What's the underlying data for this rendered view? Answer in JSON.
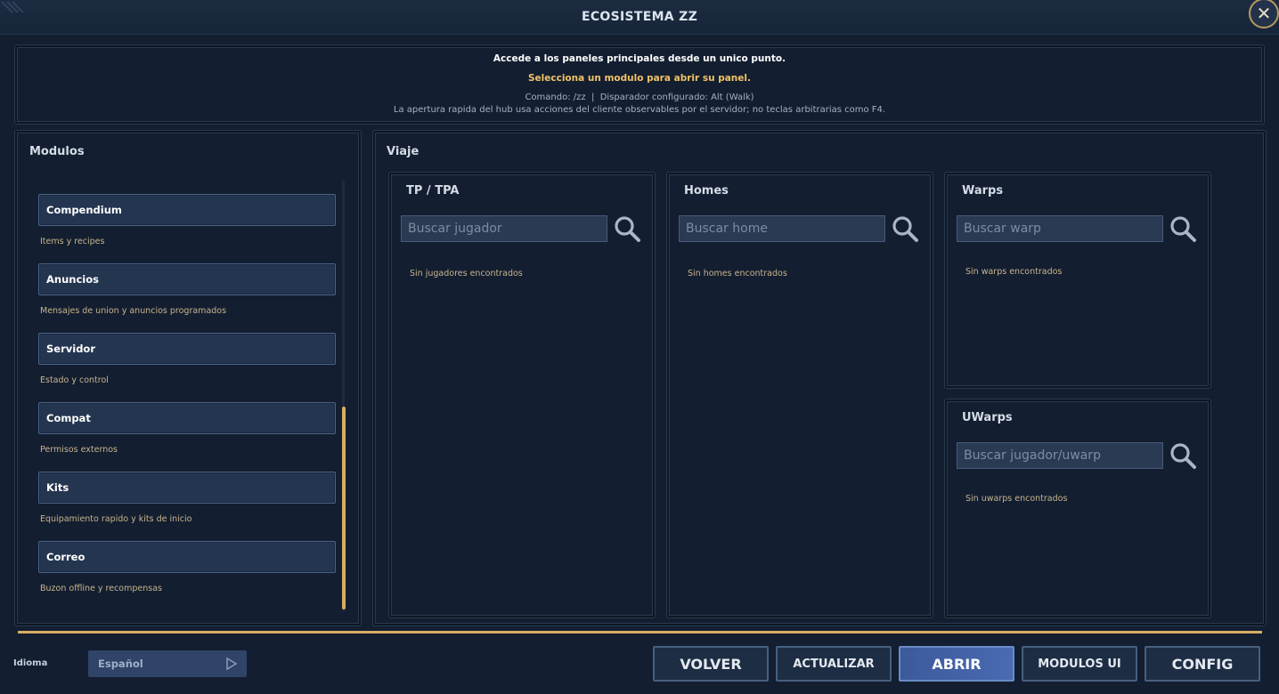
{
  "window": {
    "title": "ECOSISTEMA ZZ",
    "close_icon": "close-icon"
  },
  "header": {
    "line1": "Accede a los paneles principales desde un unico punto.",
    "line2": "Selecciona un modulo para abrir su panel.",
    "line3": "Comando: /zz  |  Disparador configurado: Alt (Walk)",
    "line4": "La apertura rapida del hub usa acciones del cliente observables por el servidor; no teclas arbitrarias como F4."
  },
  "modules": {
    "title": "Modulos",
    "items": [
      {
        "label": "Compendium",
        "desc": "Items y recipes"
      },
      {
        "label": "Anuncios",
        "desc": "Mensajes de union y anuncios programados"
      },
      {
        "label": "Servidor",
        "desc": "Estado y control"
      },
      {
        "label": "Compat",
        "desc": "Permisos externos"
      },
      {
        "label": "Kits",
        "desc": "Equipamiento rapido y kits de inicio"
      },
      {
        "label": "Correo",
        "desc": "Buzon offline y recompensas"
      }
    ]
  },
  "viaje": {
    "title": "Viaje",
    "tpa": {
      "title": "TP / TPA",
      "placeholder": "Buscar jugador",
      "empty": "Sin jugadores encontrados"
    },
    "homes": {
      "title": "Homes",
      "placeholder": "Buscar home",
      "empty": "Sin homes encontrados"
    },
    "warps": {
      "title": "Warps",
      "placeholder": "Buscar warp",
      "empty": "Sin warps encontrados"
    },
    "uwarps": {
      "title": "UWarps",
      "placeholder": "Buscar jugador/uwarp",
      "empty": "Sin uwarps encontrados"
    }
  },
  "footer": {
    "language_label": "Idioma",
    "language_value": "Español",
    "buttons": {
      "volver": "VOLVER",
      "actualizar": "ACTUALIZAR",
      "abrir": "ABRIR",
      "modulos_ui": "MODULOS UI",
      "config": "CONFIG"
    }
  },
  "colors": {
    "accent": "#d8ad62",
    "highlight_text": "#f0c267",
    "primary_button": "#4a6ab2"
  }
}
